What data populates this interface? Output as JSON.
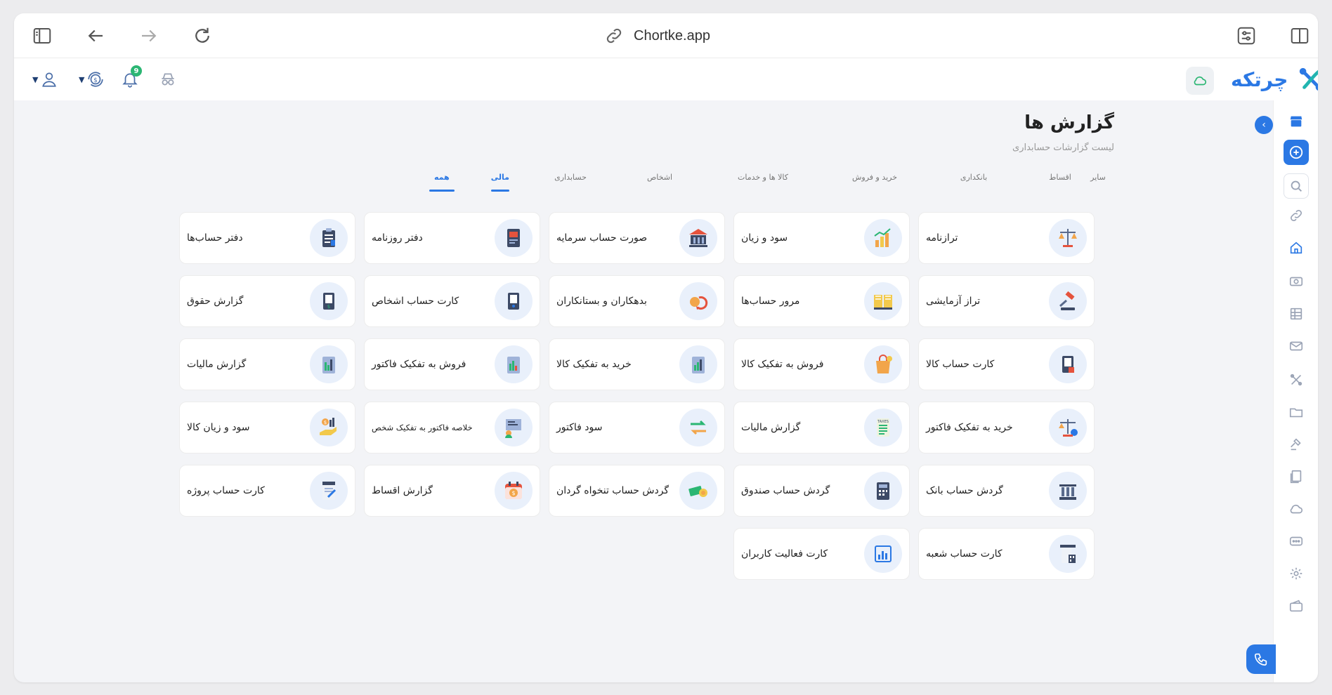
{
  "browser": {
    "url": "Chortke.app"
  },
  "brand": {
    "name": "چرتکه"
  },
  "page": {
    "title": "گزارش ها",
    "subtitle": "لیست گزارشات حسابداری"
  },
  "tabs": [
    {
      "label": "همه",
      "active": true
    },
    {
      "label": "مالی",
      "active": true
    },
    {
      "label": "حسابداری",
      "active": false
    },
    {
      "label": "اشخاص",
      "active": false
    },
    {
      "label": "کالا ها و خدمات",
      "active": false
    },
    {
      "label": "خرید و فروش",
      "active": false
    },
    {
      "label": "بانکداری",
      "active": false
    },
    {
      "label": "اقساط",
      "active": false
    },
    {
      "label": "سایر",
      "active": false
    }
  ],
  "header": {
    "notification_count": "9"
  },
  "reports": [
    {
      "label": "ترازنامه",
      "icon": "scale-icon"
    },
    {
      "label": "سود و زیان",
      "icon": "profit-chart-icon"
    },
    {
      "label": "صورت حساب سرمایه",
      "icon": "bank-building-icon"
    },
    {
      "label": "دفتر روزنامه",
      "icon": "journal-book-icon"
    },
    {
      "label": "دفتر حساب‌ها",
      "icon": "ledger-clipboard-icon"
    },
    {
      "label": "تراز آزمایشی",
      "icon": "gavel-icon"
    },
    {
      "label": "مرور حساب‌ها",
      "icon": "open-book-icon"
    },
    {
      "label": "بدهکاران و بستانکاران",
      "icon": "debt-cycle-icon"
    },
    {
      "label": "کارت حساب اشخاص",
      "icon": "person-card-icon"
    },
    {
      "label": "گزارش حقوق",
      "icon": "salary-report-icon"
    },
    {
      "label": "کارت حساب کالا",
      "icon": "product-card-icon"
    },
    {
      "label": "فروش به تفکیک کالا",
      "icon": "shopping-bag-icon"
    },
    {
      "label": "خرید به تفکیک کالا",
      "icon": "purchase-chart-icon"
    },
    {
      "label": "فروش به تفکیک فاکتور",
      "icon": "sales-invoice-icon"
    },
    {
      "label": "گزارش مالیات",
      "icon": "tax-chart-icon"
    },
    {
      "label": "خرید به تفکیک فاکتور",
      "icon": "invoice-scale-icon"
    },
    {
      "label": "گزارش مالیات",
      "icon": "taxes-document-icon"
    },
    {
      "label": "سود فاکتور",
      "icon": "invoice-profit-icon"
    },
    {
      "label": "خلاصه فاکتور به تفکیک شخص",
      "icon": "presentation-icon"
    },
    {
      "label": "سود و زیان کالا",
      "icon": "hand-money-icon"
    },
    {
      "label": "گردش حساب بانک",
      "icon": "bank-columns-icon"
    },
    {
      "label": "گردش حساب صندوق",
      "icon": "cash-register-icon"
    },
    {
      "label": "گردش حساب تنخواه گردان",
      "icon": "cash-coins-icon"
    },
    {
      "label": "گزارش اقساط",
      "icon": "calendar-money-icon"
    },
    {
      "label": "کارت حساب پروژه",
      "icon": "project-card-icon"
    },
    {
      "label": "کارت حساب شعبه",
      "icon": "branch-building-icon"
    },
    {
      "label": "کارت فعالیت کاربران",
      "icon": "activity-chart-icon"
    }
  ],
  "colors": {
    "accent": "#2b78e4",
    "green": "#2bb673",
    "card_icon_bg": "#e9f0fb"
  }
}
